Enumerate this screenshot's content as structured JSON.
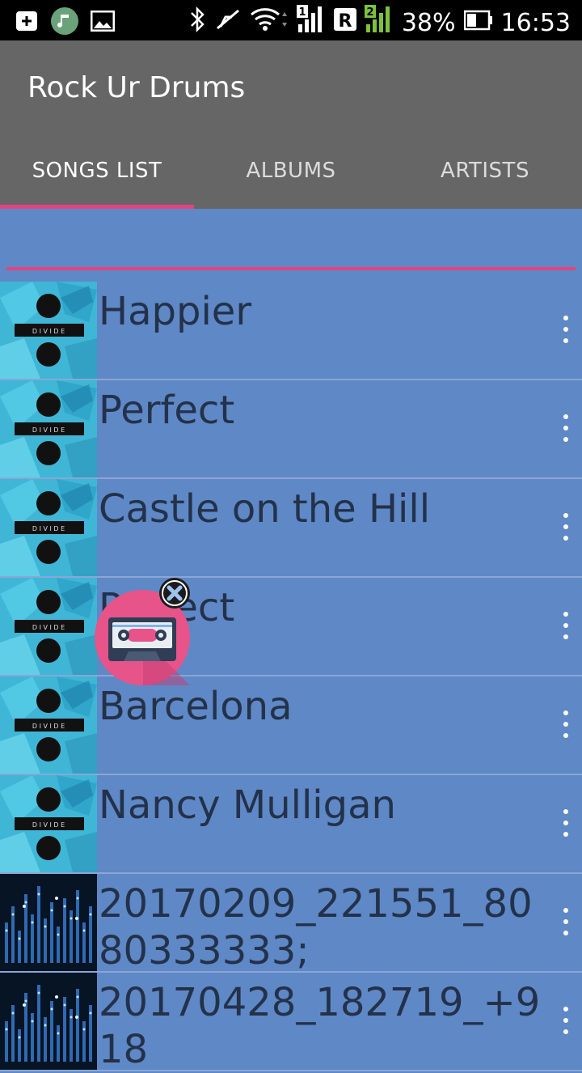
{
  "status_bar": {
    "battery": "38%",
    "time": "16:53",
    "sim1": "1",
    "sim2": "2",
    "roaming": "R"
  },
  "app": {
    "title": "Rock Ur Drums"
  },
  "tabs": [
    {
      "label": "SONGS LIST",
      "active": true
    },
    {
      "label": "ALBUMS",
      "active": false
    },
    {
      "label": "ARTISTS",
      "active": false
    }
  ],
  "songs": [
    {
      "title": "Happier",
      "art": "divide"
    },
    {
      "title": "Perfect",
      "art": "divide"
    },
    {
      "title": "Castle on the Hill",
      "art": "divide"
    },
    {
      "title": "Perfect",
      "art": "divide"
    },
    {
      "title": "Barcelona",
      "art": "divide"
    },
    {
      "title": "Nancy Mulligan",
      "art": "divide"
    },
    {
      "title": "20170209_221551_8080333333;",
      "art": "drum-town"
    },
    {
      "title": "20170428_182719_+918",
      "art": "drum-town"
    }
  ],
  "colors": {
    "list_bg": "#5f88c6",
    "appbar_bg": "#666666",
    "accent": "#e0457d",
    "title_text": "#23324a"
  }
}
